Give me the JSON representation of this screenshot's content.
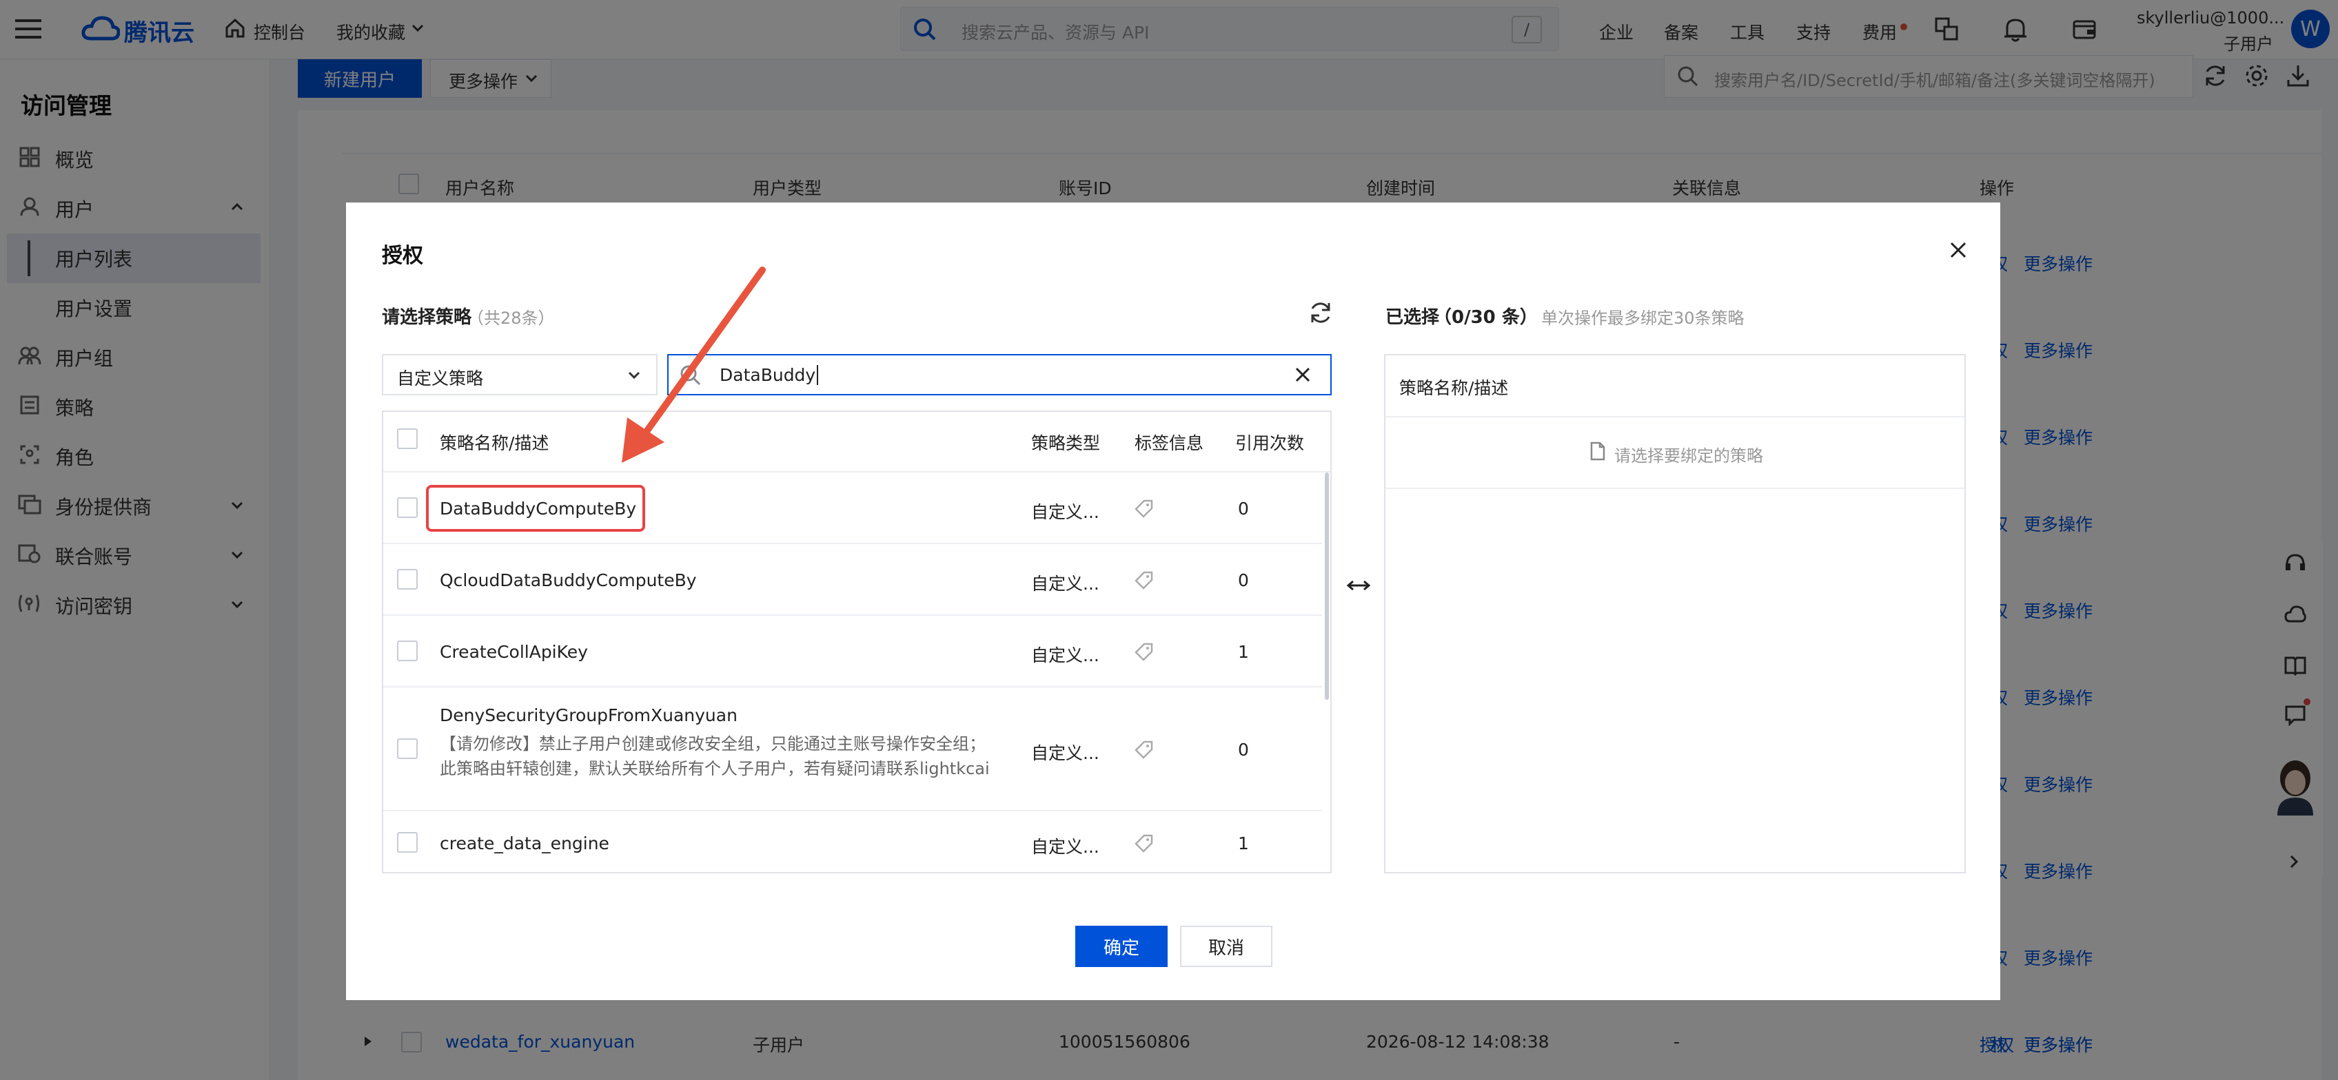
{
  "topbar": {
    "brand": "腾讯云",
    "console": "控制台",
    "favorites": "我的收藏",
    "search_placeholder": "搜索云产品、资源与 API",
    "shortcut": "/",
    "nav": [
      "企业",
      "备案",
      "工具",
      "支持",
      "费用"
    ],
    "account": "skyllerliu@1000...",
    "account_type": "子用户",
    "avatar": "W"
  },
  "sidebar": {
    "title": "访问管理",
    "items": [
      {
        "label": "概览"
      },
      {
        "label": "用户"
      },
      {
        "label": "用户列表"
      },
      {
        "label": "用户设置"
      },
      {
        "label": "用户组"
      },
      {
        "label": "策略"
      },
      {
        "label": "角色"
      },
      {
        "label": "身份提供商"
      },
      {
        "label": "联合账号"
      },
      {
        "label": "访问密钥"
      }
    ]
  },
  "toolbar": {
    "new_user": "新建用户",
    "more_ops": "更多操作",
    "search_placeholder": "搜索用户名/ID/SecretId/手机/邮箱/备注(多关键词空格隔开)"
  },
  "user_table": {
    "headers": [
      "用户名称",
      "用户类型",
      "账号ID",
      "创建时间",
      "关联信息",
      "操作"
    ],
    "row_action_partial": "权",
    "more_ops": "更多操作",
    "last_row": {
      "name": "wedata_for_xuanyuan",
      "type": "子用户",
      "id": "100051560806",
      "created": "2026-08-12 14:08:38",
      "assoc": "-",
      "action": "授权",
      "more": "更多操作"
    }
  },
  "modal": {
    "title": "授权",
    "select_label": "请选择策略",
    "select_count": "（共28条）",
    "policy_type_select": "自定义策略",
    "search_value": "DataBuddy",
    "columns": [
      "策略名称/描述",
      "策略类型",
      "标签信息",
      "引用次数"
    ],
    "rows": [
      {
        "name": "DataBuddyComputeBy",
        "desc": "",
        "type": "自定义...",
        "refs": "0"
      },
      {
        "name": "QcloudDataBuddyComputeBy",
        "desc": "",
        "type": "自定义...",
        "refs": "0"
      },
      {
        "name": "CreateCollApiKey",
        "desc": "",
        "type": "自定义...",
        "refs": "1"
      },
      {
        "name": "DenySecurityGroupFromXuanyuan",
        "desc": "【请勿修改】禁止子用户创建或修改安全组，只能通过主账号操作安全组；",
        "desc2": "此策略由轩辕创建，默认关联给所有个人子用户，若有疑问请联系lightkcai",
        "type": "自定义...",
        "refs": "0"
      },
      {
        "name": "create_data_engine",
        "desc": "",
        "type": "自定义...",
        "refs": "1"
      }
    ],
    "selected_label": "已选择",
    "selected_count": "（0/30 条）",
    "selected_hint": "单次操作最多绑定30条策略",
    "selected_column": "策略名称/描述",
    "empty_hint": "请选择要绑定的策略",
    "confirm": "确定",
    "cancel": "取消"
  },
  "colors": {
    "brand_blue": "#0052d9",
    "highlight_red": "#e54545",
    "arrow": "#e8553e"
  }
}
